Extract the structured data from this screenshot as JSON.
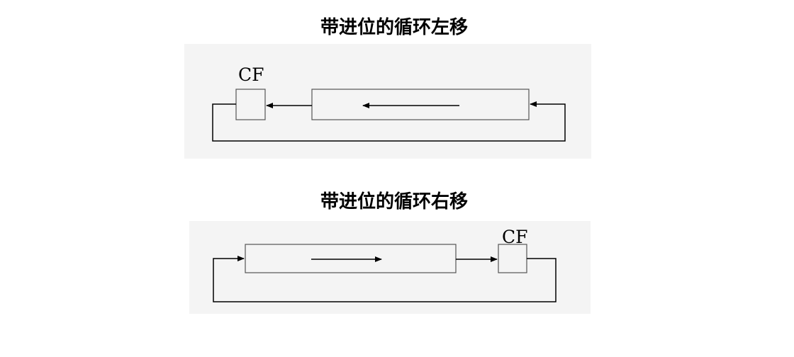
{
  "diagrams": {
    "rotate_left": {
      "title": "带进位的循环左移",
      "carry_label": "CF"
    },
    "rotate_right": {
      "title": "带进位的循环右移",
      "carry_label": "CF"
    }
  }
}
